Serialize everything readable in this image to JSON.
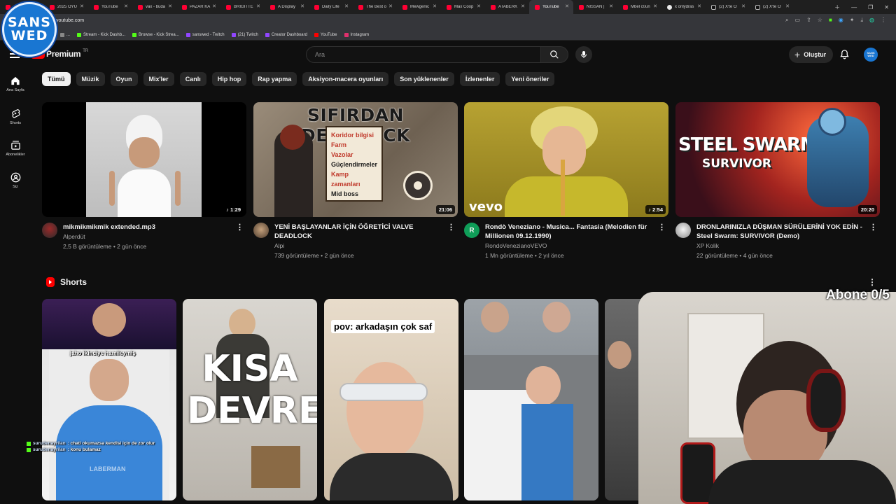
{
  "browser": {
    "tabs": [
      {
        "label": "",
        "icon": "youtube"
      },
      {
        "label": "2025 OYU",
        "icon": "youtube"
      },
      {
        "label": "YouTube",
        "icon": "youtube"
      },
      {
        "label": "vax - buda",
        "icon": "youtube"
      },
      {
        "label": "PAZAR KA",
        "icon": "youtube"
      },
      {
        "label": "BRIGITTE",
        "icon": "youtube"
      },
      {
        "label": "A Display",
        "icon": "youtube"
      },
      {
        "label": "Daily Life",
        "icon": "youtube"
      },
      {
        "label": "The Best o",
        "icon": "youtube"
      },
      {
        "label": "Mewgenic",
        "icon": "youtube"
      },
      {
        "label": "Max Coop",
        "icon": "youtube"
      },
      {
        "label": "ATABERK",
        "icon": "youtube"
      },
      {
        "label": "YouTube",
        "icon": "youtube",
        "active": true
      },
      {
        "label": "NISSAN |",
        "icon": "youtube"
      },
      {
        "label": "Mbel c0un",
        "icon": "youtube"
      },
      {
        "label": "x onlydras",
        "icon": "globe"
      },
      {
        "label": "(2) X'te O",
        "icon": "x"
      },
      {
        "label": "(2) X'te O",
        "icon": "x"
      }
    ],
    "url": "youtube.com",
    "bookmarks": [
      {
        "label": "...",
        "color": "#888888"
      },
      {
        "label": "Stream - Kick Dashb...",
        "color": "#53fc18"
      },
      {
        "label": "Browse - Kick Strea...",
        "color": "#53fc18"
      },
      {
        "label": "sanswed - Twitch",
        "color": "#9146ff"
      },
      {
        "label": "(21) Twitch",
        "color": "#9146ff"
      },
      {
        "label": "Creator Dashboard",
        "color": "#9146ff"
      },
      {
        "label": "YouTube",
        "color": "#ff0000"
      },
      {
        "label": "Instagram",
        "color": "#e1306c"
      }
    ]
  },
  "overlay": {
    "logo_line1": "SANS",
    "logo_line2": "WED",
    "sub_counter": "Abone 0/5",
    "chat": [
      {
        "user": "surudenayrilan",
        "message": ": chati okumazsa kendisi için de zor olur"
      },
      {
        "user": "surudenayrilan",
        "message": ": konu bulamaz"
      }
    ]
  },
  "header": {
    "logo_text": "Premium",
    "country": "TR",
    "search_placeholder": "Ara",
    "create_label": "Oluştur",
    "avatar_line1": "SANS",
    "avatar_line2": "WED"
  },
  "sidebar": {
    "items": [
      {
        "label": "Ana Sayfa",
        "icon": "home-icon"
      },
      {
        "label": "Shorts",
        "icon": "shorts-icon"
      },
      {
        "label": "Abonelikler",
        "icon": "subscriptions-icon"
      },
      {
        "label": "Siz",
        "icon": "you-icon"
      }
    ]
  },
  "chips": [
    "Tümü",
    "Müzik",
    "Oyun",
    "Mix'ler",
    "Canlı",
    "Hip hop",
    "Rap yapma",
    "Aksiyon-macera oyunları",
    "Son yüklenenler",
    "İzlenenler",
    "Yeni öneriler"
  ],
  "videos": [
    {
      "title": "mikmikmikmik extended.mp3",
      "channel": "Alperdüt",
      "meta": "2,5 B görüntüleme • 2 gün önce",
      "duration": "♪ 1:29",
      "thumb_text": ""
    },
    {
      "title": "YENİ BAŞLAYANLAR İÇİN ÖĞRETİCİ VALVE DEADLOCK",
      "channel": "Alpi",
      "meta": "739 görüntüleme • 2 gün önce",
      "duration": "21:06",
      "thumb_text": "SIFIRDAN DEADLOCK",
      "thumb_list": [
        "Koridor bilgisi",
        "Farm",
        "Vazolar",
        "Güçlendirmeler",
        "Kamp zamanları",
        "Mid boss"
      ]
    },
    {
      "title": "Rondò Veneziano - Musica... Fantasia (Melodien für Millionen 09.12.1990)",
      "channel": "RondoVenezianoVEVO",
      "meta": "1 Mn görüntüleme • 2 yıl önce",
      "duration": "♪ 2:54",
      "thumb_text": "vevo",
      "avatar_letter": "R"
    },
    {
      "title": "DRONLARINIZLA DÜŞMAN SÜRÜLERİNİ YOK EDİN - Steel Swarm: SURVIVOR (Demo)",
      "channel": "XP Kolik",
      "meta": "22 görüntüleme • 4 gün önce",
      "duration": "20:20",
      "thumb_text": "STEEL SWARM",
      "thumb_sub": "SURVIVOR"
    }
  ],
  "shorts": {
    "title": "Shorts",
    "items": [
      {
        "caption": "jaho ikinciye hamileymiş",
        "watermark": "LABERMAN"
      },
      {
        "caption": "KISA DEVRE"
      },
      {
        "caption": "pov: arkadaşın çok saf"
      },
      {
        "caption": ""
      },
      {
        "caption": ""
      }
    ]
  }
}
